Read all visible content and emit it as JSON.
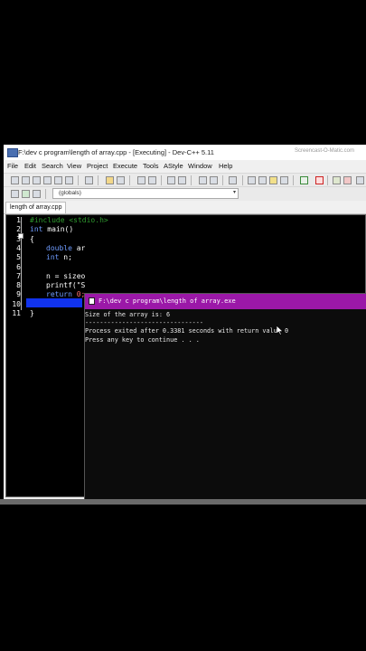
{
  "window": {
    "title": "F:\\dev c program\\length of array.cpp - [Executing] - Dev-C++ 5.11",
    "watermark": "Screencast-O-Matic.com"
  },
  "menu": [
    "File",
    "Edit",
    "Search",
    "View",
    "Project",
    "Execute",
    "Tools",
    "AStyle",
    "Window",
    "Help"
  ],
  "toolbar": {
    "scope_value": "(globals)"
  },
  "tab": {
    "label": "length of array.cpp"
  },
  "editor": {
    "line_numbers": [
      "1",
      "2",
      "3",
      "4",
      "5",
      "6",
      "7",
      "8",
      "9",
      "10",
      "11"
    ],
    "lines": {
      "l1": "#include <stdio.h>",
      "l2_kw": "int",
      "l2_rest": " main()",
      "l3": "{",
      "l4_kw": "double",
      "l4_rest": " ar",
      "l5_kw": "int",
      "l5_rest": " n;",
      "l7": "n = sizeo",
      "l8": "printf(\"S",
      "l9_kw": "return",
      "l9_num": " 0;",
      "l11": "}"
    }
  },
  "console": {
    "title": "F:\\dev c program\\length of array.exe",
    "line1": "Size of the array is: 6",
    "line2": "",
    "line3": "--------------------------------",
    "line4": "Process exited after 0.3381 seconds with return value 0",
    "line5": "Press any key to continue . . ."
  },
  "colors": {
    "console_title_bg": "#9b18a8",
    "editor_bg": "#000000",
    "line_highlight": "#1133ee"
  }
}
